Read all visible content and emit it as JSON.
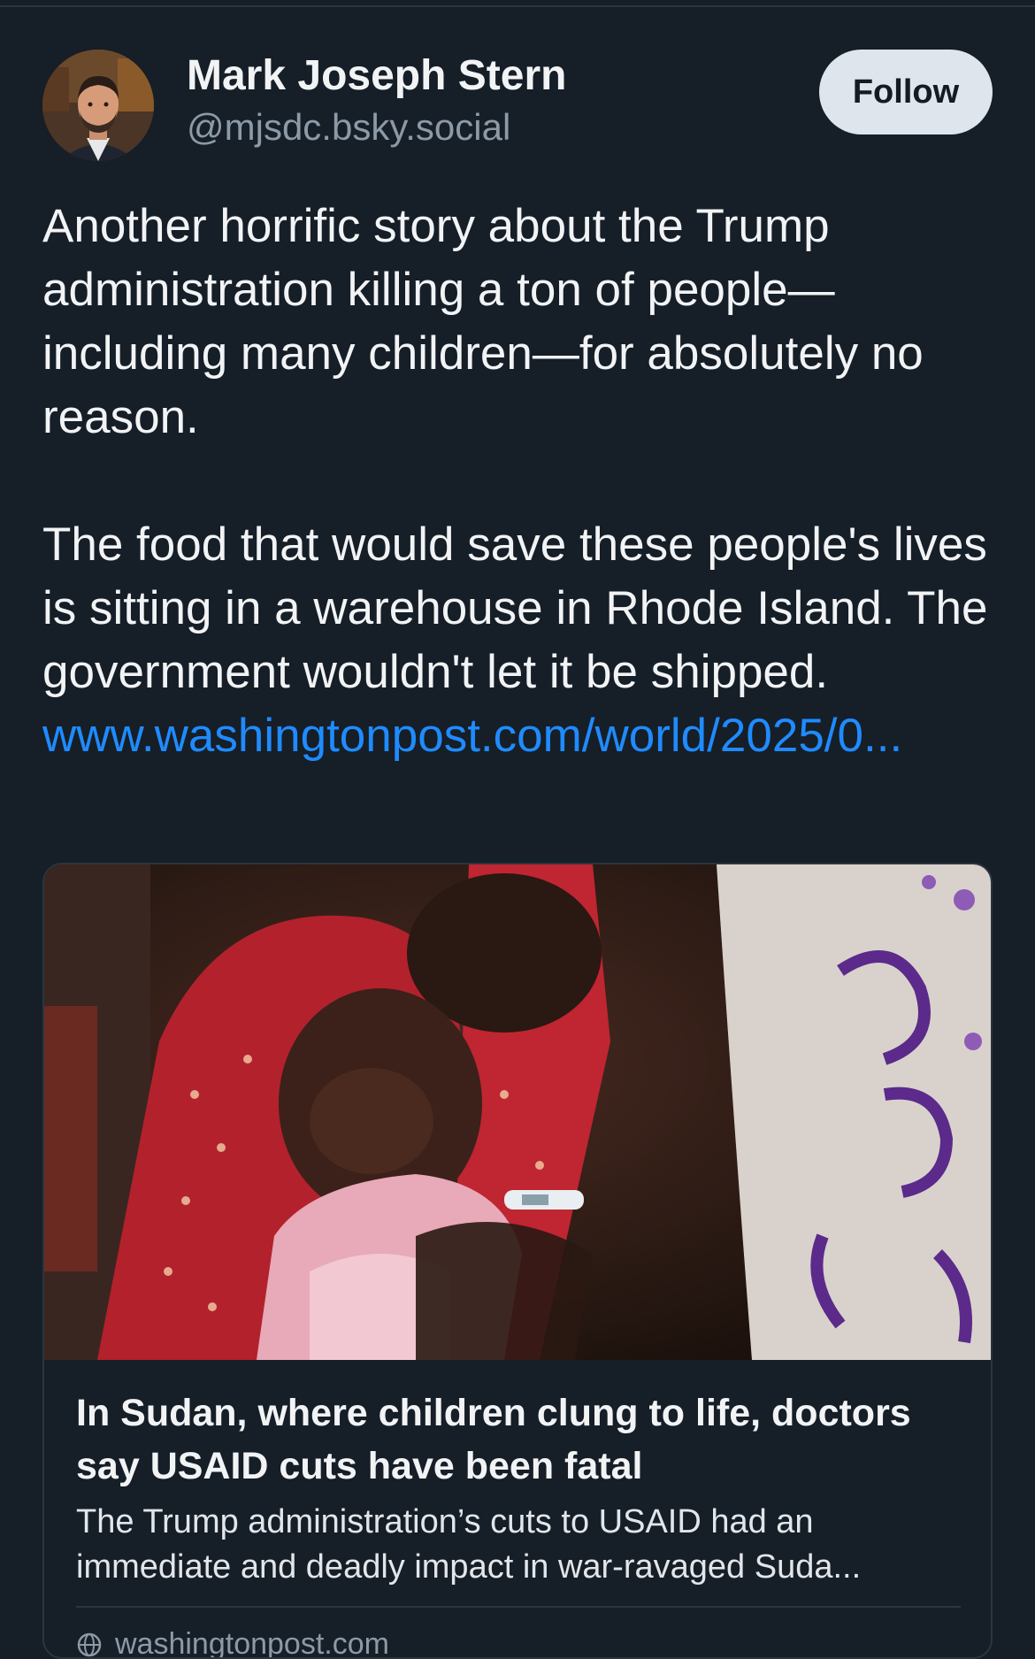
{
  "author": {
    "display_name": "Mark Joseph Stern",
    "handle": "@mjsdc.bsky.social",
    "avatar_icon": "avatar-photo"
  },
  "follow_label": "Follow",
  "post": {
    "paragraph1": "Another horrific story about the Trump administration killing a ton of people—including many children—for absolutely no reason.",
    "paragraph2_text": "The food that would save these people's lives is sitting in a warehouse in Rhode Island. The government wouldn't let it be shipped. ",
    "link_text": "www.washingtonpost.com/world/2025/0..."
  },
  "embed": {
    "title": "In Sudan, where children clung to life, doctors say USAID cuts have been fatal",
    "description_line1": "The Trump administration’s cuts to USAID had an",
    "description_line2": "immediate and deadly impact in war-ravaged Suda...",
    "domain": "washingtonpost.com",
    "domain_icon": "globe-icon"
  },
  "colors": {
    "background": "#161e27",
    "link": "#1f8bfe",
    "follow_button_bg": "#dfe5ec",
    "muted_text": "#8c9aa8"
  }
}
